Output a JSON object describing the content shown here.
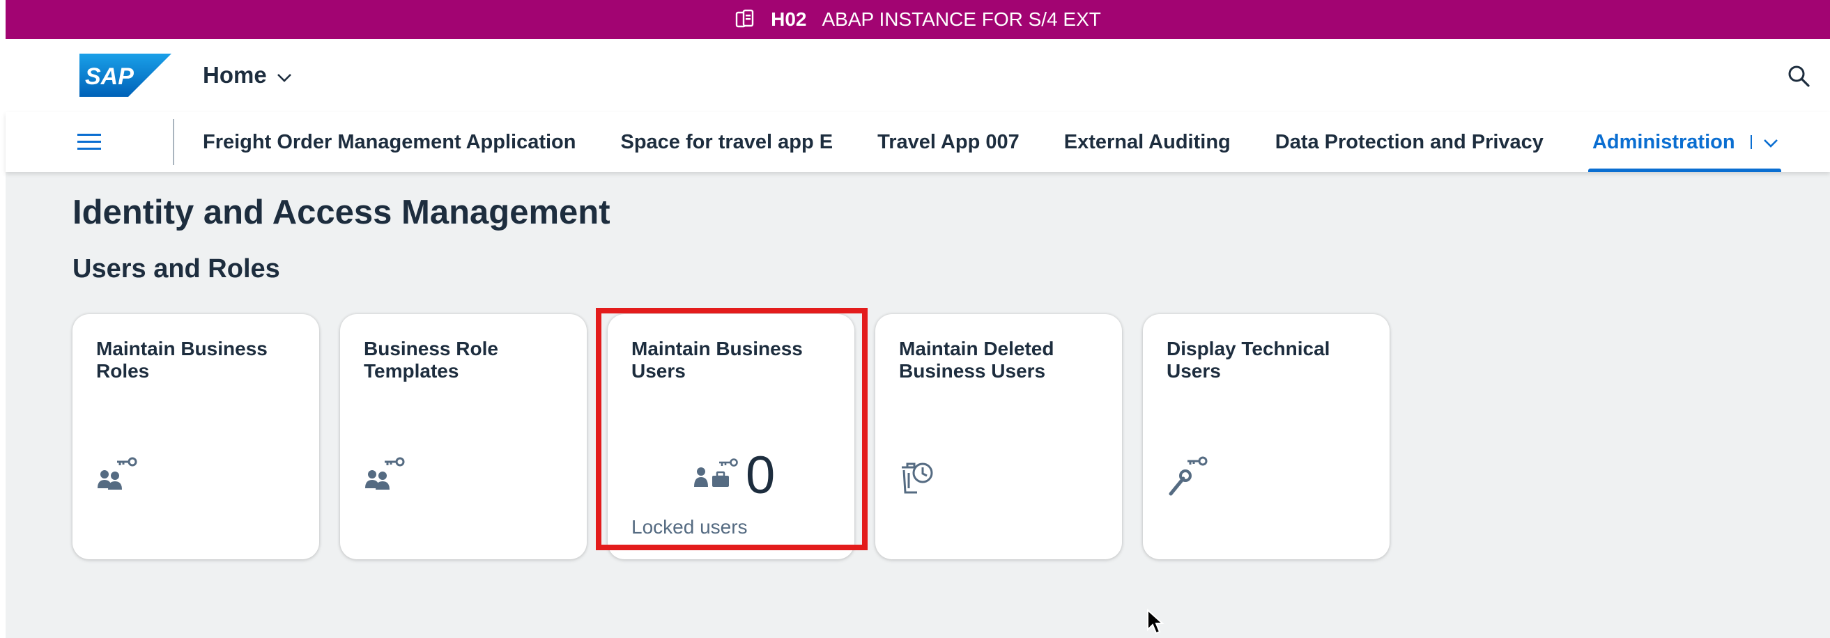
{
  "system_bar": {
    "system_id": "H02",
    "description": "ABAP INSTANCE FOR S/4 EXT",
    "icon": "system-icon",
    "background": "#a20472"
  },
  "shell": {
    "logo_text": "SAP",
    "home_label": "Home",
    "search_icon": "search-icon",
    "menu_icon": "hamburger-icon"
  },
  "spaces": [
    {
      "label": "Freight Order Management Application",
      "active": false
    },
    {
      "label": "Space for travel app E",
      "active": false
    },
    {
      "label": "Travel App 007",
      "active": false
    },
    {
      "label": "External Auditing",
      "active": false
    },
    {
      "label": "Data Protection and Privacy",
      "active": false
    },
    {
      "label": "Administration",
      "active": true
    }
  ],
  "page": {
    "title": "Identity and Access Management",
    "section": "Users and Roles"
  },
  "tiles": [
    {
      "title": "Maintain Business Roles",
      "icon": "business-roles-icon"
    },
    {
      "title": "Business Role Templates",
      "icon": "role-templates-icon"
    },
    {
      "title": "Maintain Business Users",
      "icon": "business-users-icon",
      "kpi": "0",
      "footer": "Locked users",
      "highlighted": true
    },
    {
      "title": "Maintain Deleted Business Users",
      "icon": "deleted-users-icon"
    },
    {
      "title": "Display Technical Users",
      "icon": "technical-users-icon"
    }
  ],
  "colors": {
    "accent": "#0a6ed1",
    "text": "#1d2d3e",
    "content_bg": "#eff1f2",
    "highlight": "#e31c1c"
  }
}
